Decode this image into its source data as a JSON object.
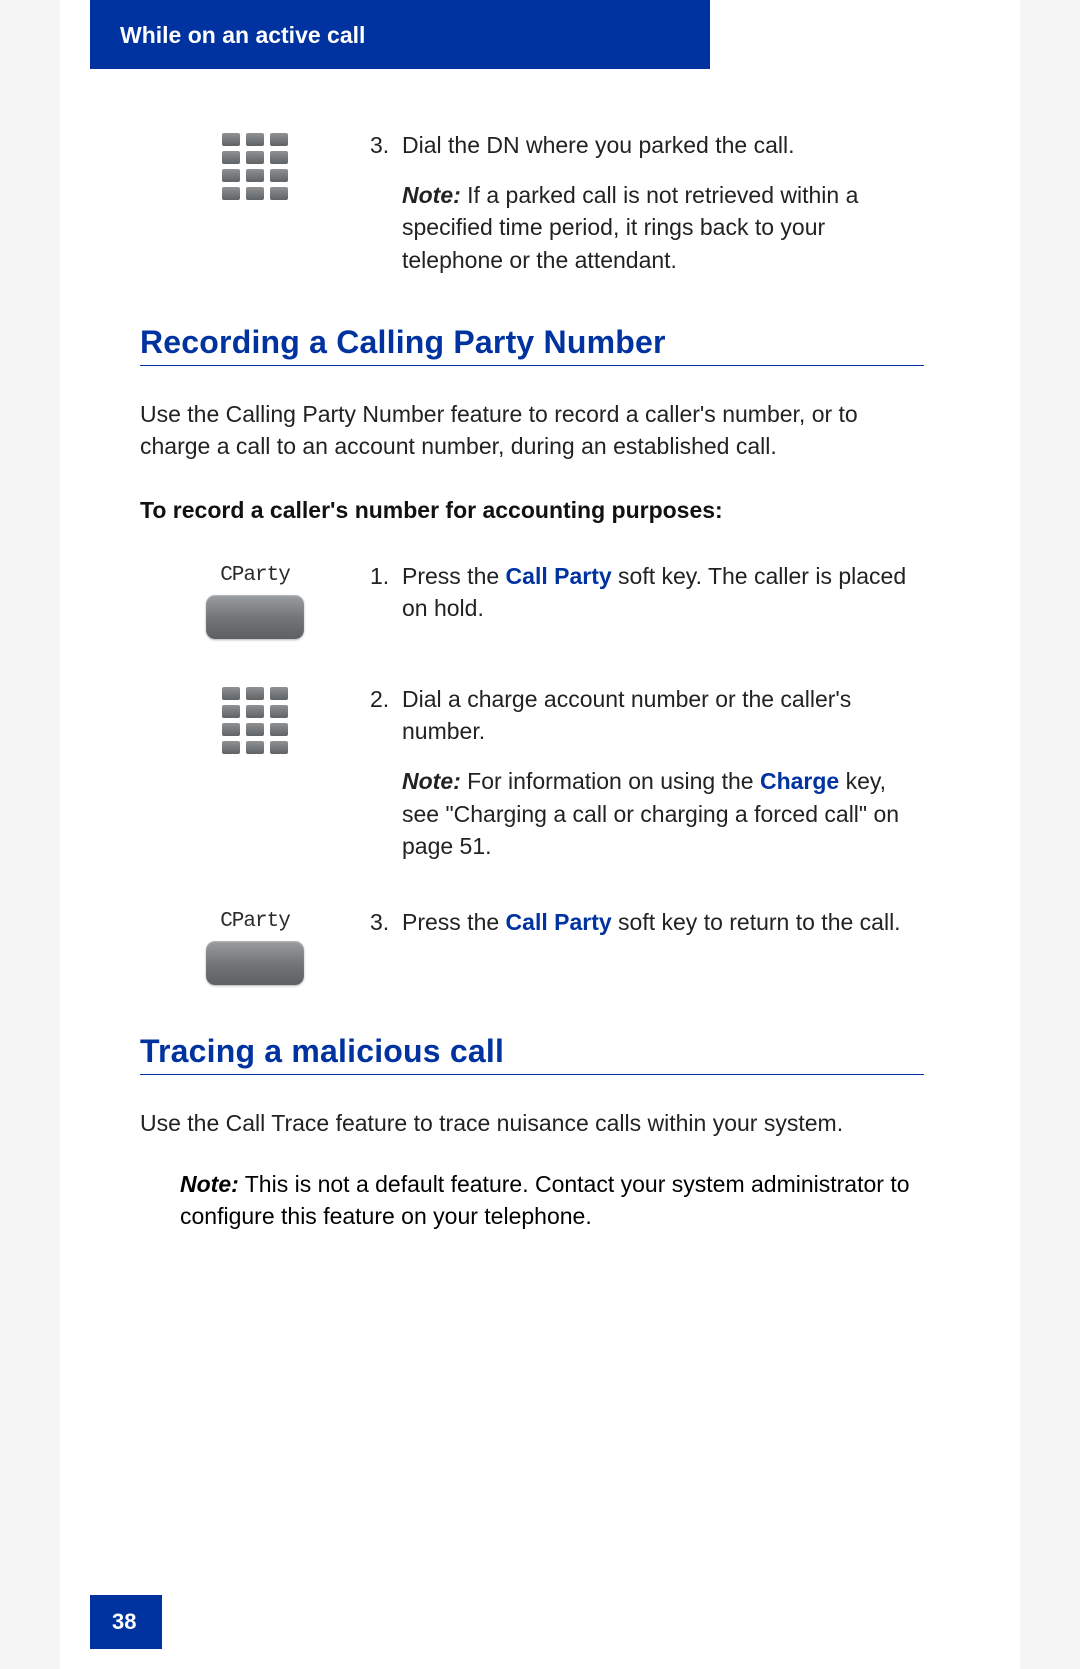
{
  "header": {
    "title": "While on an active call"
  },
  "intro_step": {
    "num": "3.",
    "text": "Dial the DN where you parked the call.",
    "note_label": "Note:",
    "note_text": " If a parked call is not retrieved within a specified time period, it rings back to your telephone or the attendant."
  },
  "section1": {
    "heading": "Recording a Calling Party Number",
    "para": "Use the Calling Party Number feature to record a caller's number, or to charge a call to an account number, during an established call.",
    "subhead": "To record a caller's number for accounting purposes:",
    "steps": [
      {
        "num": "1.",
        "softkey_label": "CParty",
        "pre": "Press the ",
        "key": "Call Party",
        "post": " soft key. The caller is placed on hold."
      },
      {
        "num": "2.",
        "icon": "keypad",
        "text": "Dial a charge account number or the caller's number.",
        "note_label": "Note:",
        "note_pre": " For information on using the ",
        "note_key": "Charge",
        "note_post": " key, see \"Charging a call or charging a forced call\" on page 51."
      },
      {
        "num": "3.",
        "softkey_label": "CParty",
        "pre": "Press the ",
        "key": "Call Party",
        "post": " soft key to return to the call."
      }
    ]
  },
  "section2": {
    "heading": "Tracing a malicious call",
    "para": "Use the Call Trace feature to trace nuisance calls within your system.",
    "note_label": "Note:",
    "note_text": "  This is not a default feature. Contact your system administrator to configure this feature on your telephone."
  },
  "page_number": "38"
}
